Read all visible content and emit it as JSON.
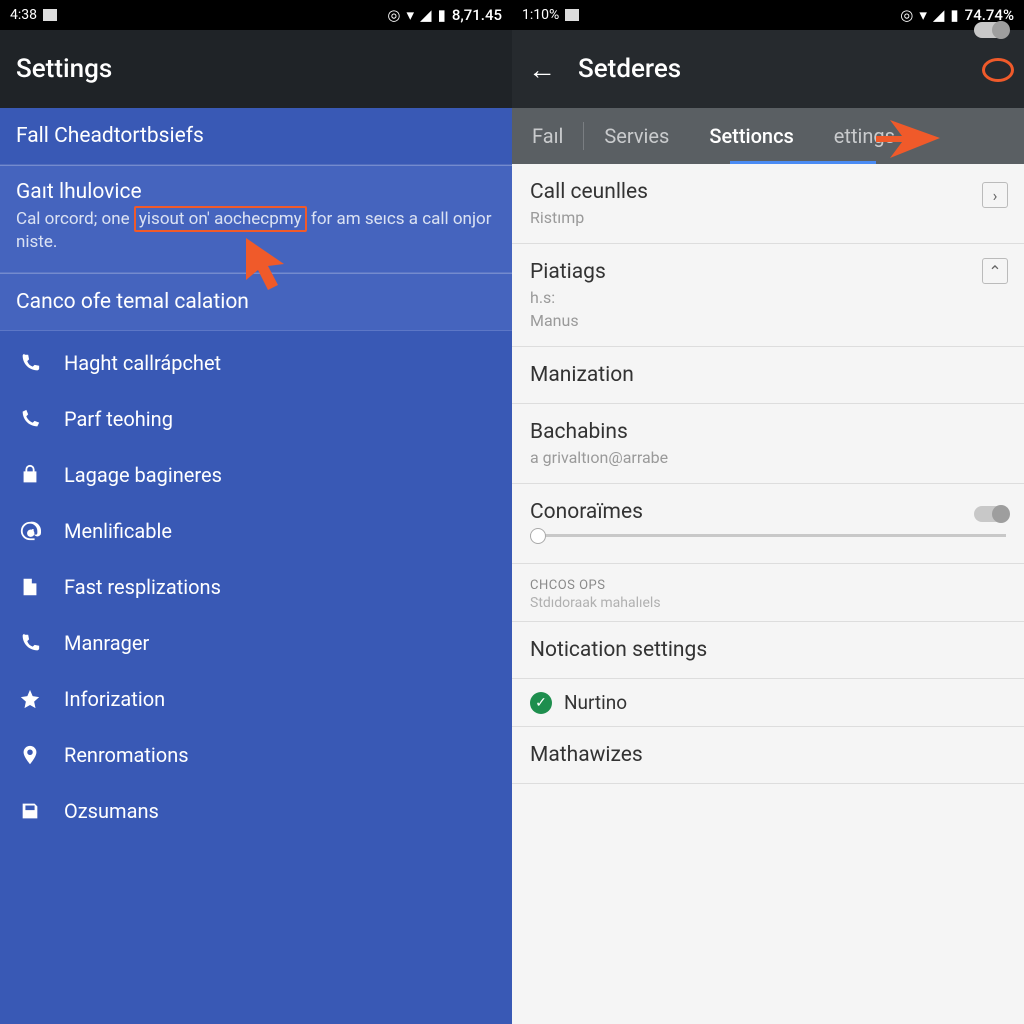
{
  "left": {
    "statusbar": {
      "time": "4:38",
      "battery": "8,71.45"
    },
    "appbar": {
      "title": "Settings"
    },
    "sections": {
      "fall": "Fall Cheadtortbsiefs",
      "gait_title": "Gaıt lhulovice",
      "gait_desc_pre": "Cal orcord; one ",
      "gait_desc_box": "yisout on' aochecpmy",
      "gait_desc_post": " for am seıcs a call onjor niste.",
      "canco": "Canco ofe temal calation"
    },
    "menu": [
      {
        "icon": "phone-handset-icon",
        "label": "Haght callrápchet"
      },
      {
        "icon": "phone-dial-icon",
        "label": "Parf teohing"
      },
      {
        "icon": "lock-bag-icon",
        "label": "Lagage bagineres"
      },
      {
        "icon": "at-sign-icon",
        "label": "Menlificable"
      },
      {
        "icon": "document-icon",
        "label": "Fast resplizations"
      },
      {
        "icon": "phone-icon",
        "label": "Manrager"
      },
      {
        "icon": "star-icon",
        "label": "Inforization"
      },
      {
        "icon": "pin-icon",
        "label": "Renromations"
      },
      {
        "icon": "save-icon",
        "label": "Ozsumans"
      }
    ]
  },
  "right": {
    "statusbar": {
      "time": "1:10%",
      "battery": "74.74%"
    },
    "appbar": {
      "title": "Setderes"
    },
    "tabs": {
      "fail": "Faıl",
      "servies": "Servies",
      "settioncs": "Settioncs",
      "settings": "ettings"
    },
    "rows": {
      "call_centles": {
        "title": "Call ceunlles",
        "sub": "Ristımp"
      },
      "piatiags": {
        "title": "Piatiags",
        "sub1": "h.s:",
        "sub2": "Manus"
      },
      "manization": {
        "title": "Manization"
      },
      "bachabins": {
        "title": "Bachabins",
        "sub": "a grivaltıon@arrabe"
      },
      "conoratmes": {
        "title": "Conoraïmes"
      },
      "header": {
        "label": "CHCOS OPS",
        "sub": "Stdıdoraak mahalıels"
      },
      "notication": {
        "title": "Notication settings"
      },
      "nurtino": {
        "label": "Nurtino"
      },
      "mathawizes": {
        "title": "Mathawizes"
      }
    }
  }
}
